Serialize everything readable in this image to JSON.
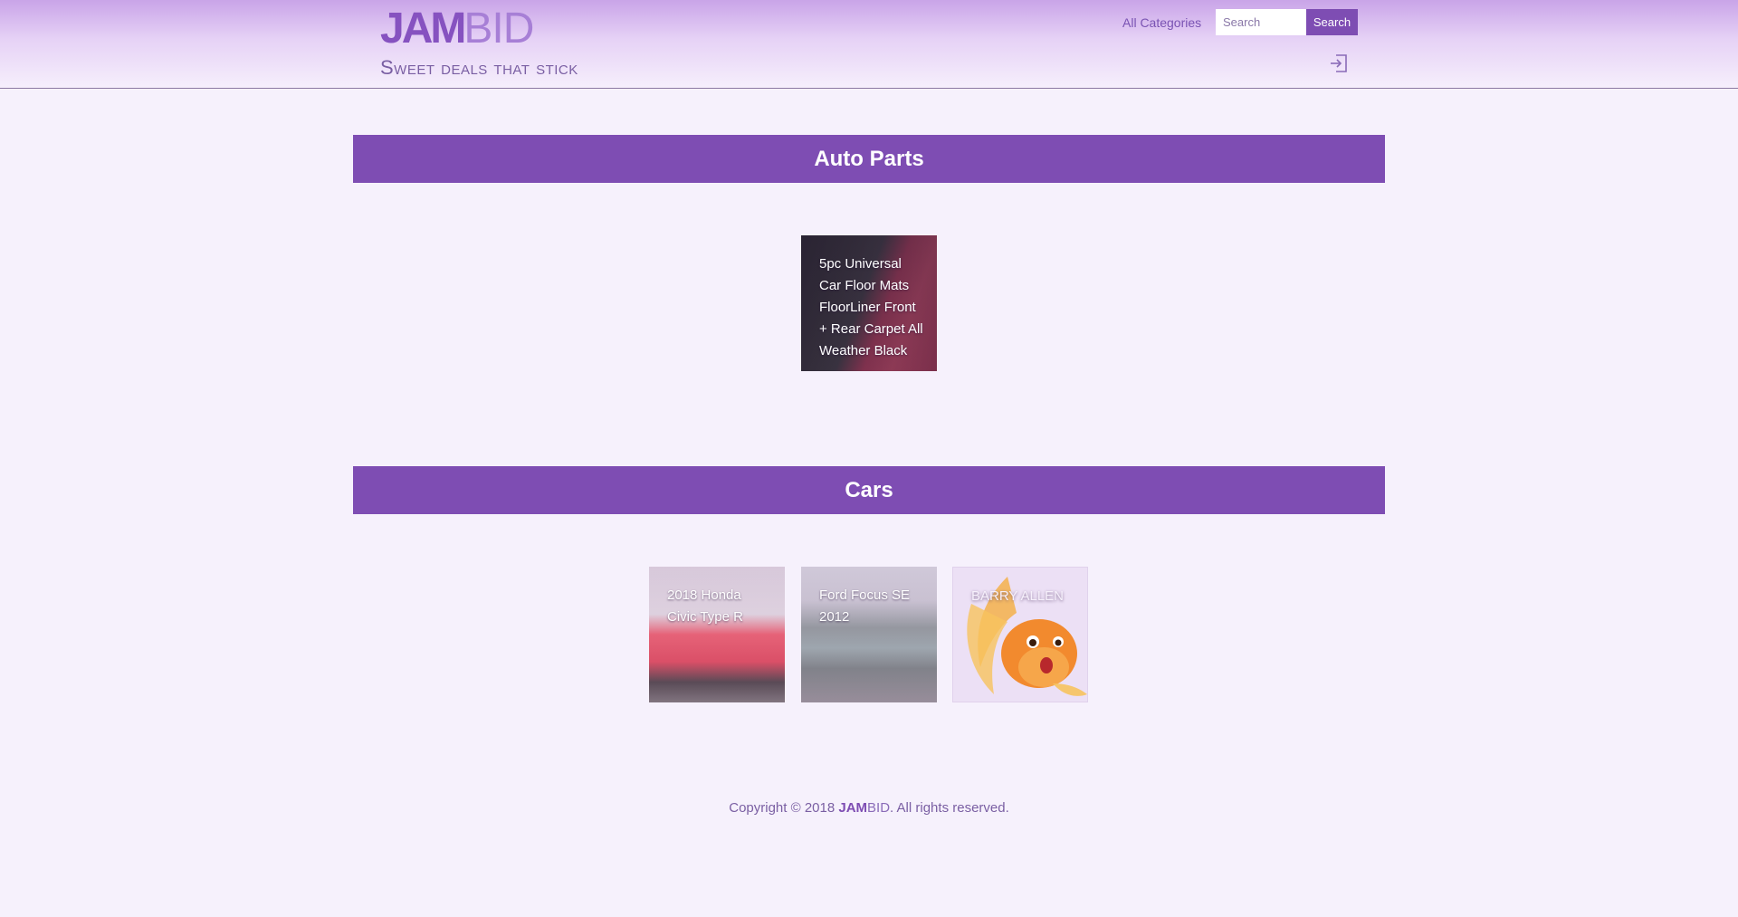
{
  "header": {
    "logo_jam": "JAM",
    "logo_bid": "BID",
    "tagline": "Sweet deals that stick",
    "nav_all_categories": "All Categories",
    "search": {
      "placeholder": "Search",
      "button_label": "Search"
    },
    "login_icon": "sign-in-icon"
  },
  "sections": [
    {
      "title": "Auto Parts",
      "items": [
        {
          "title": "5pc Universal Car Floor Mats FloorLiner Front + Rear Carpet All Weather Black"
        }
      ]
    },
    {
      "title": "Cars",
      "items": [
        {
          "title": "2018 Honda Civic Type R"
        },
        {
          "title": "Ford Focus SE 2012"
        },
        {
          "title": "BARRY ALLEN"
        }
      ]
    }
  ],
  "footer": {
    "prefix": "Copyright © 2018",
    "brand_jam": "JAM",
    "brand_bid": "BID",
    "suffix": ". All rights reserved."
  },
  "colors": {
    "accent": "#7e4db3",
    "background": "#f6f1fc"
  }
}
